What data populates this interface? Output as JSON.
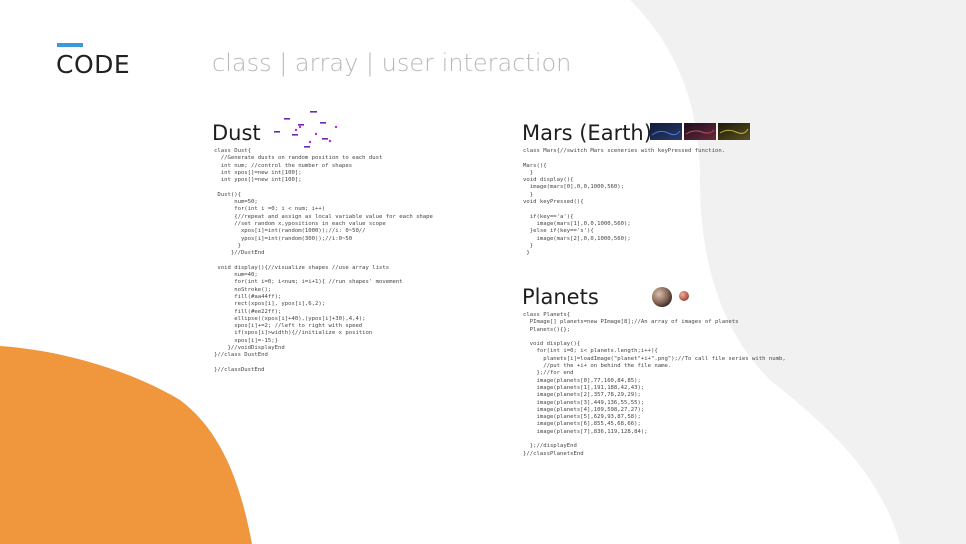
{
  "slide": {
    "label": "CODE",
    "title": "class | array | user interaction",
    "accent_color": "#3a9ad9",
    "blob_color": "#f0963c",
    "panel_color": "#f1f1f1"
  },
  "sections": {
    "dust": {
      "heading": "Dust",
      "thumbnail_icon": "dust-particles-icon",
      "code": "class Dust{\n  //Generate dusts on random position to each dust\n  int num; //control the number of shapes\n  int xpos[]=new int[100];\n  int ypos[]=new int[100];\n\n Dust(){\n      num=50;\n      for(int i =0; i < num; i++)\n      {//repeat and assign as local variable value for each shape\n      //set random x,ypositions in each value scope\n        xpos[i]=int(random(1000));//i: 0~50//\n        ypos[i]=int(random(300));//i:0~50\n       }\n     }//DustEnd\n\n void display(){//visualize shapes //use array lists\n      num=40;\n      for(int i=0; i<num; i=i+1){ //run shapes' movement\n      noStroke();\n      fill(#aa44ff);\n      rect(xpos[i], ypos[i],6,2);\n      fill(#ee22ff);\n      ellipse((xpos[i]+40),(ypos[i]+30),4,4);\n      xpos[i]+=2; //left to right with speed\n      if(xpos[i]>width){//initialize x position\n      xpos[i]=-15;}\n    }//voidDisplayEnd\n}//class DustEnd\n\n}//classDustEnd"
    },
    "mars": {
      "heading": "Mars (Earth)",
      "thumbnail_icon": "mars-scenery-thumbnails-icon",
      "code": "class Mars{//switch Mars sceneries with keyPressed function.\n\nMars(){\n  }\nvoid display(){\n  image(mars[0],0,0,1000,560);\n  }\nvoid keyPressed(){\n\n  if(key=='a'){\n    image(mars[1],0,0,1000,560);\n  }else if(key=='s'){\n    image(mars[2],0,0,1000,560);\n  }\n }"
    },
    "planets": {
      "heading": "Planets",
      "thumbnail_icon": "planet-spheres-icon",
      "code": "class Planets{\n  PImage[] planets=new PImage[8];//An array of images of planets\n  Planets(){};\n\n  void display(){\n    for(int i=0; i< planets.length;i++){\n      planets[i]=loadImage(\"planet\"+i+\".png\");//To call file series with numb,\n      //put the +i+ on behind the file name.\n    };//for end\n    image(planets[0],77,160,84,85);\n    image(planets[1],191,188,42,43);\n    image(planets[2],357,78,29,29);\n    image(planets[3],449,136,55,55);\n    image(planets[4],109,598,27,27);\n    image(planets[5],629,93,87,58);\n    image(planets[6],855,45,68,66);\n    image(planets[7],836,119,128,84);\n\n  };//displayEnd\n}//classPlanetsEnd"
    }
  }
}
